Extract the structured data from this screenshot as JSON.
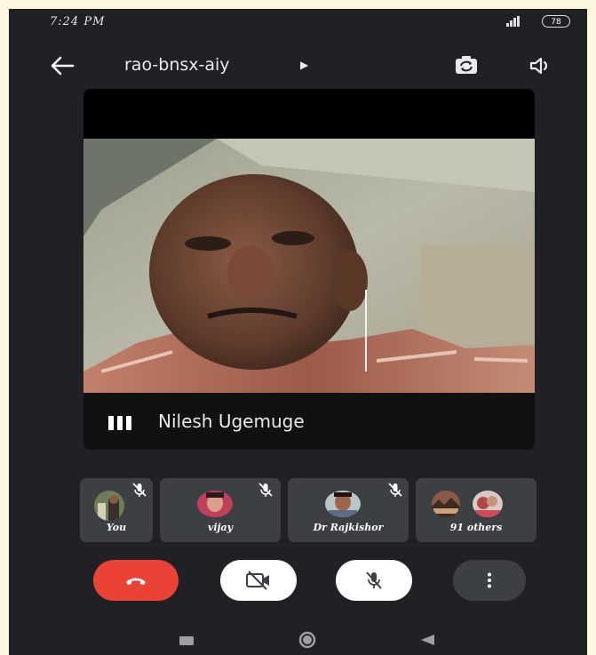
{
  "status_bar": {
    "time": "7:24 PM",
    "battery": "78"
  },
  "app_bar": {
    "back_icon": "arrow-left-icon",
    "meeting_code": "rao-bnsx-aiy",
    "expand_icon": "caret-right-icon",
    "switch_camera_icon": "switch-camera-icon",
    "speaker_icon": "speaker-icon"
  },
  "main_tile": {
    "speaker_name": "Nilesh Ugemuge",
    "audio_icon": "audio-level-icon"
  },
  "participants": [
    {
      "label": "You",
      "muted": true
    },
    {
      "label": "vijay",
      "muted": true
    },
    {
      "label": "Dr Rajkishor",
      "muted": true
    },
    {
      "label": "91 others",
      "muted": false
    }
  ],
  "controls": [
    {
      "name": "end-call",
      "icon": "phone-hangup-icon",
      "color": "#ea4335"
    },
    {
      "name": "camera-off",
      "icon": "video-off-icon",
      "color": "#ffffff"
    },
    {
      "name": "mic-off",
      "icon": "mic-off-icon",
      "color": "#ffffff"
    },
    {
      "name": "more-options",
      "icon": "more-vert-icon",
      "color": "#3c4043"
    }
  ],
  "nav_bar": {
    "recents_icon": "square-icon",
    "home_icon": "circle-icon",
    "back_icon": "triangle-back-icon"
  }
}
